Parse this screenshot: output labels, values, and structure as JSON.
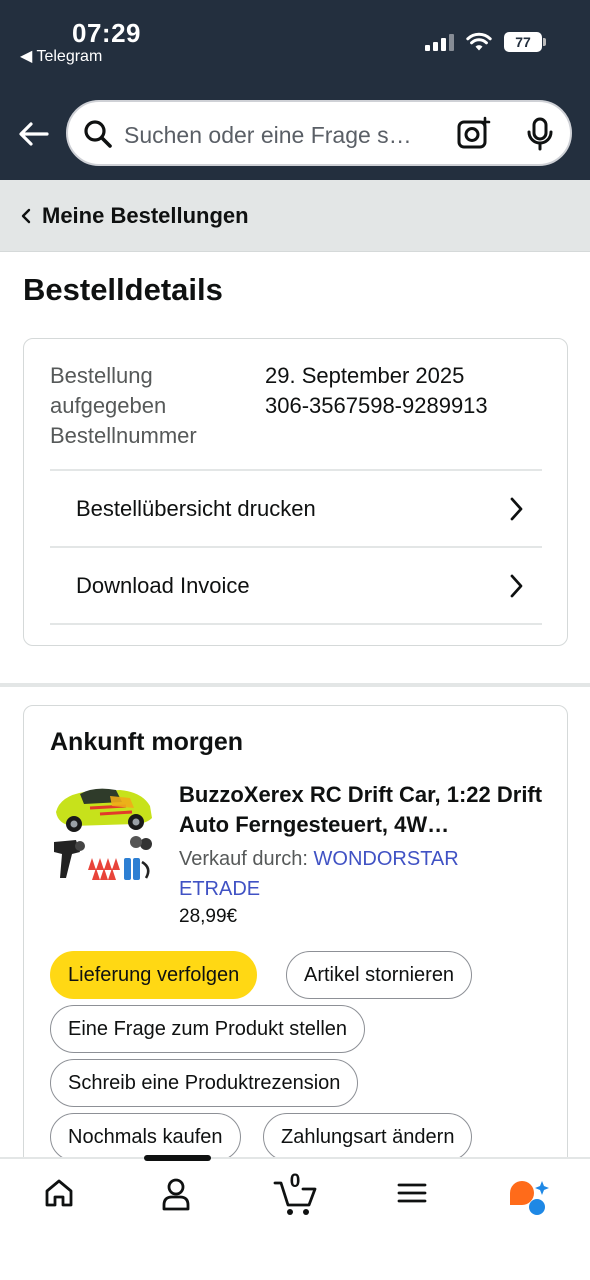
{
  "status_bar": {
    "time": "07:29",
    "back_app": "◀ Telegram",
    "battery": "77"
  },
  "search": {
    "placeholder": "Suchen oder eine Frage s…"
  },
  "breadcrumb": {
    "label": "Meine Bestellungen"
  },
  "page_title": "Bestelldetails",
  "order_info": {
    "placed_label": "Bestellung aufgegeben",
    "number_label": "Bestellnummer",
    "placed_date": "29. September 2025",
    "order_number": "306-3567598-9289913",
    "print_summary": "Bestellübersicht drucken",
    "download_invoice": "Download Invoice"
  },
  "shipment": {
    "arrival": "Ankunft morgen",
    "product_title": "BuzzoXerex RC Drift Car, 1:22 Drift Auto Ferngesteuert, 4W…",
    "seller_prefix": "Verkauf durch: ",
    "seller_name": "WONDORSTAR ETRADE",
    "price": "28,99€",
    "actions": {
      "track": "Lieferung verfolgen",
      "cancel": "Artikel stornieren",
      "ask": "Eine Frage zum Produkt stellen",
      "review": "Schreib eine Produktrezension",
      "buy_again": "Nochmals kaufen",
      "change_payment": "Zahlungsart ändern"
    }
  },
  "bottom_nav": {
    "cart_count": "0",
    "icons": [
      "home-icon",
      "account-icon",
      "cart-icon",
      "menu-icon",
      "rufus-icon"
    ]
  },
  "colors": {
    "header_bg": "#232f3e",
    "primary_button": "#ffd814",
    "link": "#4052c4"
  }
}
